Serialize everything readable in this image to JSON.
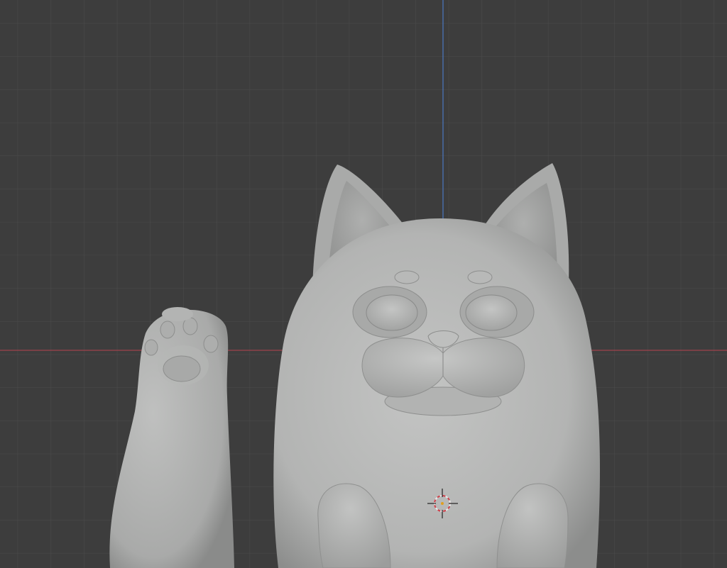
{
  "viewport": {
    "background": "#3d3d3d",
    "grid_color": "#4a4a4a",
    "x_axis_color": "#a0424d",
    "y_axis_color": "#4a74b8",
    "model_base_color": "#b8b9b8"
  },
  "scene": {
    "model_name": "maneki-neko-cat",
    "parts": [
      "body",
      "raised-paw",
      "left-ear",
      "right-ear",
      "left-eye",
      "right-eye",
      "muzzle",
      "nose",
      "chin",
      "left-brow",
      "right-brow",
      "left-front-leg",
      "right-front-leg"
    ]
  },
  "cursor": {
    "icon": "3d-cursor-icon"
  }
}
